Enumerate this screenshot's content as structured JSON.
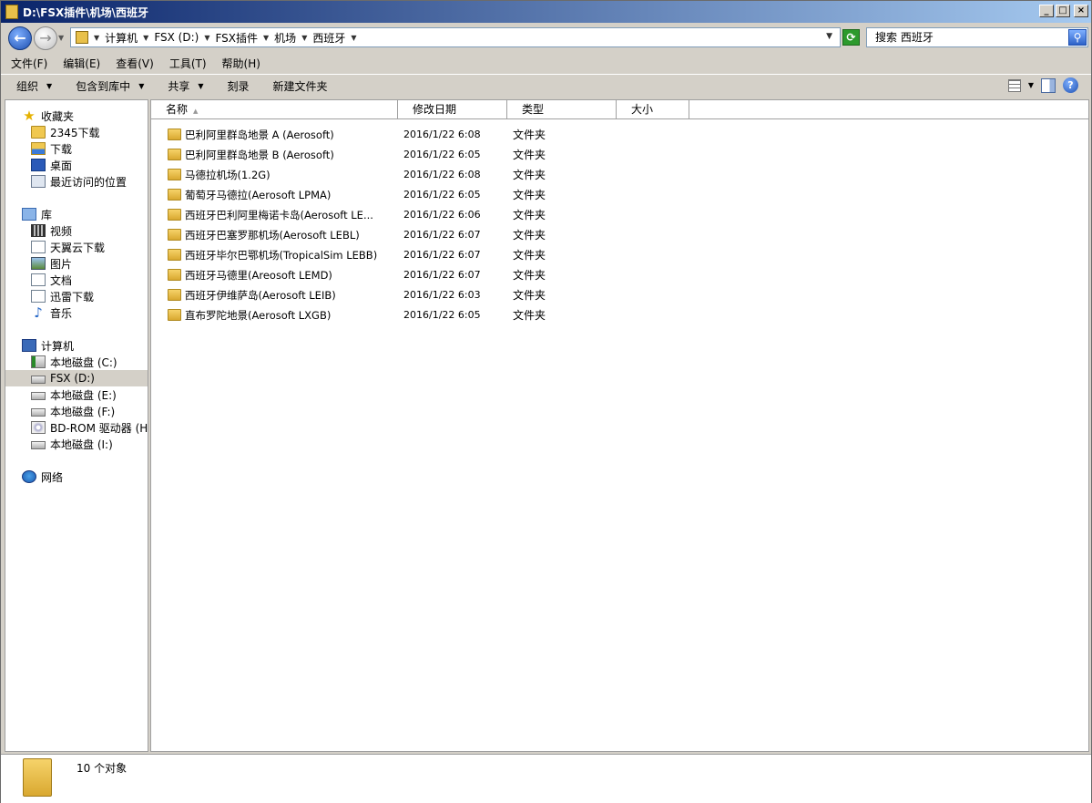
{
  "window": {
    "title": "D:\\FSX插件\\机场\\西班牙",
    "buttons": {
      "minimize": "_",
      "maximize": "□",
      "close": "×"
    }
  },
  "address": {
    "crumbs": [
      "计算机",
      "FSX (D:)",
      "FSX插件",
      "机场",
      "西班牙"
    ]
  },
  "search": {
    "placeholder": "搜索 西班牙"
  },
  "menubar": [
    "文件(F)",
    "编辑(E)",
    "查看(V)",
    "工具(T)",
    "帮助(H)"
  ],
  "toolbar": {
    "organize": "组织",
    "include": "包含到库中",
    "share": "共享",
    "burn": "刻录",
    "new_folder": "新建文件夹"
  },
  "nav": {
    "favorites": "收藏夹",
    "fav_items": [
      "2345下载",
      "下载",
      "桌面",
      "最近访问的位置"
    ],
    "libraries": "库",
    "lib_items": [
      "视频",
      "天翼云下载",
      "图片",
      "文档",
      "迅雷下载",
      "音乐"
    ],
    "computer": "计算机",
    "drives": [
      "本地磁盘 (C:)",
      "FSX (D:)",
      "本地磁盘 (E:)",
      "本地磁盘 (F:)",
      "BD-ROM 驱动器 (H:)",
      "本地磁盘 (I:)"
    ],
    "network": "网络"
  },
  "columns": {
    "name": "名称",
    "date": "修改日期",
    "type": "类型",
    "size": "大小"
  },
  "files": [
    {
      "name": "巴利阿里群岛地景 A (Aerosoft)",
      "date": "2016/1/22 6:08",
      "type": "文件夹"
    },
    {
      "name": "巴利阿里群岛地景 B (Aerosoft)",
      "date": "2016/1/22 6:05",
      "type": "文件夹"
    },
    {
      "name": "马德拉机场(1.2G)",
      "date": "2016/1/22 6:08",
      "type": "文件夹"
    },
    {
      "name": "葡萄牙马德拉(Aerosoft LPMA)",
      "date": "2016/1/22 6:05",
      "type": "文件夹"
    },
    {
      "name": "西班牙巴利阿里梅诺卡岛(Aerosoft LE...",
      "date": "2016/1/22 6:06",
      "type": "文件夹"
    },
    {
      "name": "西班牙巴塞罗那机场(Aerosoft LEBL)",
      "date": "2016/1/22 6:07",
      "type": "文件夹"
    },
    {
      "name": "西班牙毕尔巴鄂机场(TropicalSim LEBB)",
      "date": "2016/1/22 6:07",
      "type": "文件夹"
    },
    {
      "name": "西班牙马德里(Areosoft LEMD)",
      "date": "2016/1/22 6:07",
      "type": "文件夹"
    },
    {
      "name": "西班牙伊维萨岛(Aerosoft LEIB)",
      "date": "2016/1/22 6:03",
      "type": "文件夹"
    },
    {
      "name": "直布罗陀地景(Aerosoft LXGB)",
      "date": "2016/1/22 6:05",
      "type": "文件夹"
    }
  ],
  "status": {
    "count": "10 个对象"
  }
}
